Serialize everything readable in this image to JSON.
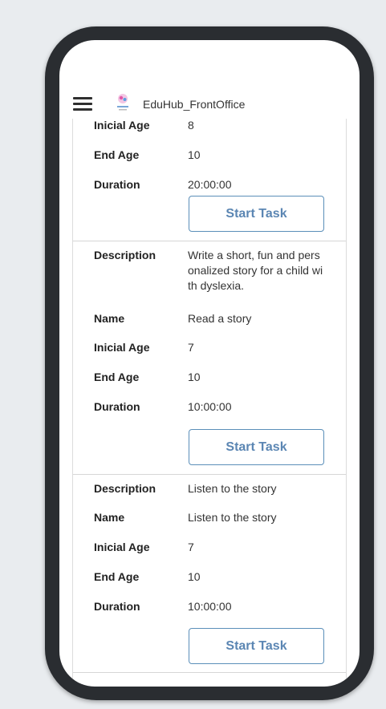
{
  "header": {
    "title": "EduHub_FrontOffice",
    "menu_icon": "hamburger-icon",
    "logo_icon": "eduhub-logo"
  },
  "labels": {
    "description": "Description",
    "name": "Name",
    "inicial_age": "Inicial Age",
    "end_age": "End Age",
    "duration": "Duration"
  },
  "tasks": [
    {
      "inicial_age": "8",
      "end_age": "10",
      "duration": "20:00:00",
      "button": "Start Task"
    },
    {
      "description": "Write a short, fun and pers onalized story for a child wi th dyslexia.",
      "name": "Read a story",
      "inicial_age": "7",
      "end_age": "10",
      "duration": "10:00:00",
      "button": "Start Task"
    },
    {
      "description": "Listen to the story",
      "name": "Listen to the story",
      "inicial_age": "7",
      "end_age": "10",
      "duration": "10:00:00",
      "button": "Start Task"
    }
  ],
  "colors": {
    "accent": "#5b86b3",
    "frame": "#2a2d31"
  }
}
